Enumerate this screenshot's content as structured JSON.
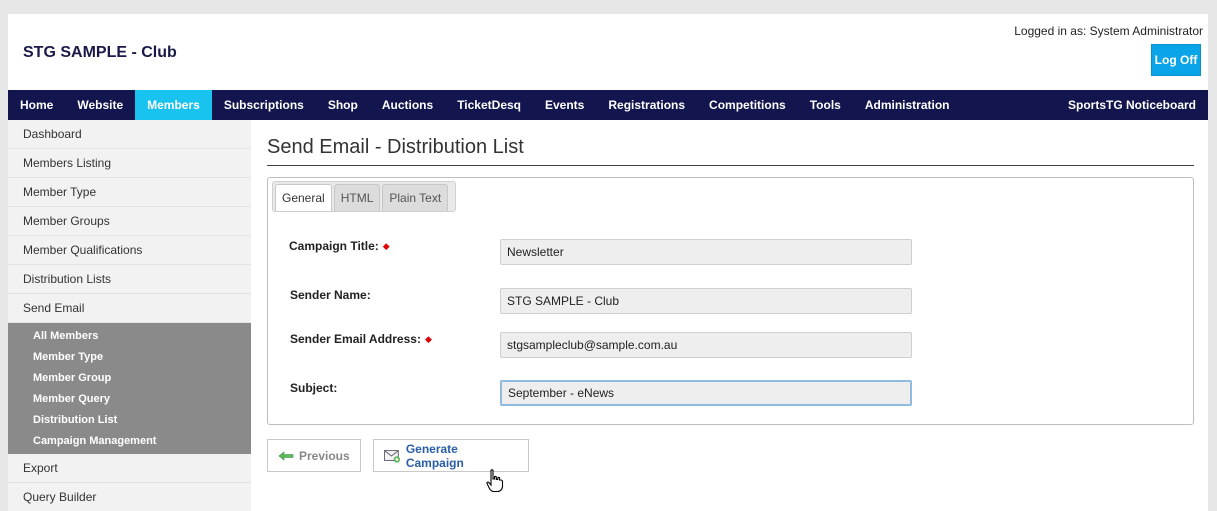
{
  "header": {
    "club_name": "STG SAMPLE - Club",
    "logged_in": "Logged in as: System Administrator",
    "logoff_label": "Log Off"
  },
  "nav": {
    "items": [
      "Home",
      "Website",
      "Members",
      "Subscriptions",
      "Shop",
      "Auctions",
      "TicketDesq",
      "Events",
      "Registrations",
      "Competitions",
      "Tools",
      "Administration"
    ],
    "active": "Members",
    "right_label": "SportsTG Noticeboard"
  },
  "sidebar": {
    "items": [
      "Dashboard",
      "Members Listing",
      "Member Type",
      "Member Groups",
      "Member Qualifications",
      "Distribution Lists",
      "Send Email"
    ],
    "sub_items": [
      "All Members",
      "Member Type",
      "Member Group",
      "Member Query",
      "Distribution List",
      "Campaign Management"
    ],
    "items_after": [
      "Export",
      "Query Builder"
    ]
  },
  "main": {
    "title": "Send Email - Distribution List",
    "tabs": [
      {
        "label": "General",
        "active": true
      },
      {
        "label": "HTML",
        "active": false
      },
      {
        "label": "Plain Text",
        "active": false
      }
    ],
    "fields": {
      "campaign_title": {
        "label": "Campaign Title:",
        "value": "Newsletter",
        "required": true
      },
      "sender_name": {
        "label": "Sender Name:",
        "value": "STG SAMPLE - Club",
        "required": false
      },
      "sender_email": {
        "label": "Sender Email Address:",
        "value": "stgsampleclub@sample.com.au",
        "required": true
      },
      "subject": {
        "label": "Subject:",
        "value": "September - eNews",
        "required": false
      }
    },
    "buttons": {
      "previous": "Previous",
      "generate": "Generate Campaign"
    }
  },
  "colors": {
    "nav_bg": "#13154e",
    "accent": "#19c3f0",
    "logoff_bg": "#0aa5e8",
    "submenu_bg": "#8a8a8a",
    "link_blue": "#2b5ea8"
  },
  "icons": {
    "previous": "arrow-left-icon",
    "generate": "envelope-icon",
    "required": "diamond-icon",
    "cursor": "hand-pointer-icon"
  }
}
